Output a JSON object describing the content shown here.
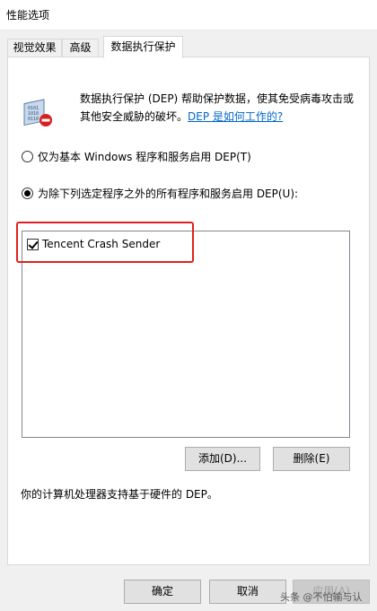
{
  "window": {
    "title": "性能选项"
  },
  "tabs": [
    {
      "label": "视觉效果"
    },
    {
      "label": "高级"
    },
    {
      "label": "数据执行保护"
    }
  ],
  "description": {
    "text_line1": "数据执行保护 (DEP) 帮助保护数据，使其免受病毒攻击或",
    "text_line2": "其他安全威胁的破坏。",
    "link": "DEP 是如何工作的?"
  },
  "options": {
    "basic": "仅为基本 Windows 程序和服务启用 DEP(T)",
    "all_except": "为除下列选定程序之外的所有程序和服务启用 DEP(U):",
    "selected": "all_except"
  },
  "program_list": [
    {
      "name": "Tencent Crash Sender",
      "checked": true
    }
  ],
  "buttons": {
    "add": "添加(D)...",
    "remove": "删除(E)",
    "ok": "确定",
    "cancel": "取消",
    "apply": "应用(A)"
  },
  "hardware_note": "你的计算机处理器支持基于硬件的 DEP。",
  "watermark": "头条 @不怕输与认",
  "colors": {
    "highlight": "#e02020",
    "link": "#0066cc"
  }
}
